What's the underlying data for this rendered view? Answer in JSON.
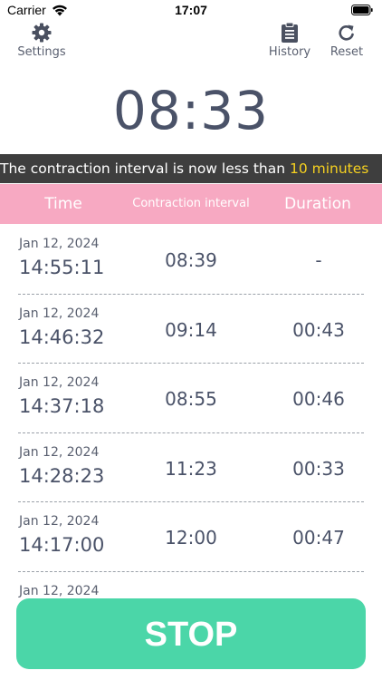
{
  "status_bar": {
    "carrier": "Carrier",
    "time": "17:07"
  },
  "toolbar": {
    "settings_label": "Settings",
    "history_label": "History",
    "reset_label": "Reset"
  },
  "timer": "08:33",
  "notice": {
    "text": "The contraction interval is now less than ",
    "highlight": "10 minutes",
    "highlight_color": "#f5d020"
  },
  "table": {
    "headers": {
      "time": "Time",
      "interval": "Contraction interval",
      "duration": "Duration"
    },
    "rows": [
      {
        "date": "Jan 12, 2024",
        "time": "14:55:11",
        "interval": "08:39",
        "duration": "-"
      },
      {
        "date": "Jan 12, 2024",
        "time": "14:46:32",
        "interval": "09:14",
        "duration": "00:43"
      },
      {
        "date": "Jan 12, 2024",
        "time": "14:37:18",
        "interval": "08:55",
        "duration": "00:46"
      },
      {
        "date": "Jan 12, 2024",
        "time": "14:28:23",
        "interval": "11:23",
        "duration": "00:33"
      },
      {
        "date": "Jan 12, 2024",
        "time": "14:17:00",
        "interval": "12:00",
        "duration": "00:47"
      },
      {
        "date": "Jan 12, 2024",
        "time": "",
        "interval": "",
        "duration": ""
      }
    ]
  },
  "stop_button": {
    "label": "STOP",
    "color": "#4bd6a8"
  },
  "colors": {
    "header_pink": "#f7a9c2",
    "banner_dark": "#3e3e3e",
    "text_slate": "#4a5268"
  }
}
